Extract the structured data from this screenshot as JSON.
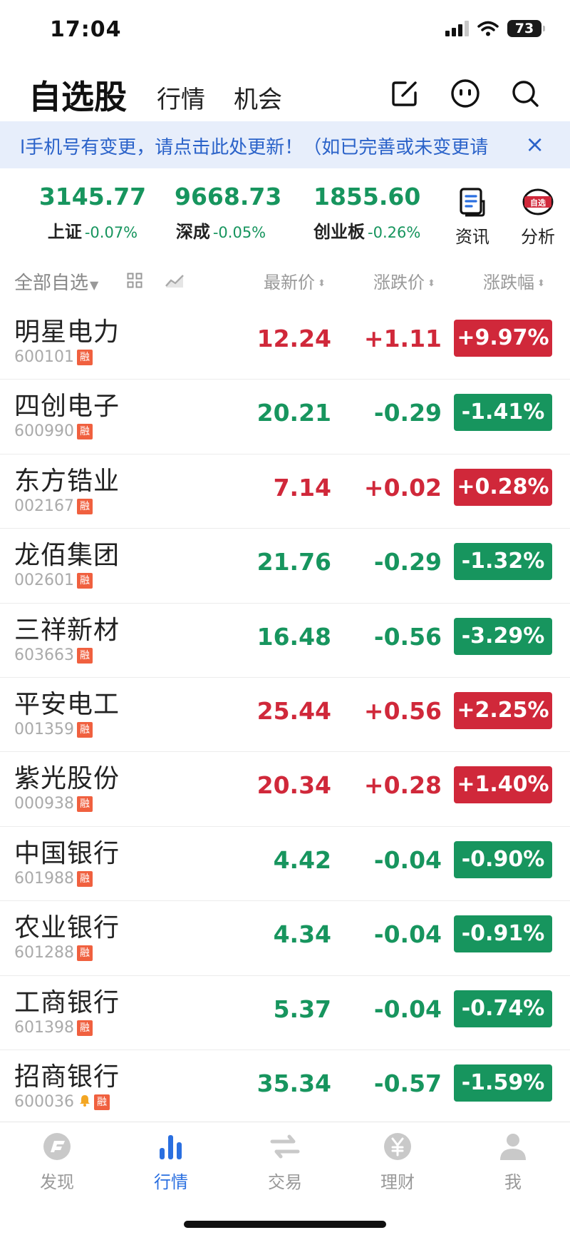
{
  "status_bar": {
    "time": "17:04",
    "battery": "73"
  },
  "header": {
    "title": "自选股",
    "tabs": [
      {
        "label": "行情"
      },
      {
        "label": "机会"
      }
    ],
    "icons": [
      "edit-icon",
      "robot-icon",
      "search-icon"
    ]
  },
  "notice": {
    "text": "l手机号有变更，请点击此处更新！（如已完善或未变更请",
    "close": "×"
  },
  "indices": [
    {
      "name": "上证",
      "value": "3145.77",
      "change": "-0.07%"
    },
    {
      "name": "深成",
      "value": "9668.73",
      "change": "-0.05%"
    },
    {
      "name": "创业板",
      "value": "1855.60",
      "change": "-0.26%"
    }
  ],
  "tools": [
    {
      "label": "资讯",
      "icon": "news-icon"
    },
    {
      "label": "分析",
      "icon": "analysis-icon",
      "badge": "自选"
    }
  ],
  "columns": {
    "all": "全部自选",
    "price": "最新价",
    "change": "涨跌价",
    "pct": "涨跌幅"
  },
  "stocks": [
    {
      "name": "明星电力",
      "code": "600101",
      "badge": "融",
      "price": "12.24",
      "change": "+1.11",
      "pct": "+9.97%",
      "dir": "up"
    },
    {
      "name": "四创电子",
      "code": "600990",
      "badge": "融",
      "price": "20.21",
      "change": "-0.29",
      "pct": "-1.41%",
      "dir": "down"
    },
    {
      "name": "东方锆业",
      "code": "002167",
      "badge": "融",
      "price": "7.14",
      "change": "+0.02",
      "pct": "+0.28%",
      "dir": "up"
    },
    {
      "name": "龙佰集团",
      "code": "002601",
      "badge": "融",
      "price": "21.76",
      "change": "-0.29",
      "pct": "-1.32%",
      "dir": "down"
    },
    {
      "name": "三祥新材",
      "code": "603663",
      "badge": "融",
      "price": "16.48",
      "change": "-0.56",
      "pct": "-3.29%",
      "dir": "down"
    },
    {
      "name": "平安电工",
      "code": "001359",
      "badge": "融",
      "price": "25.44",
      "change": "+0.56",
      "pct": "+2.25%",
      "dir": "up"
    },
    {
      "name": "紫光股份",
      "code": "000938",
      "badge": "融",
      "price": "20.34",
      "change": "+0.28",
      "pct": "+1.40%",
      "dir": "up"
    },
    {
      "name": "中国银行",
      "code": "601988",
      "badge": "融",
      "price": "4.42",
      "change": "-0.04",
      "pct": "-0.90%",
      "dir": "down"
    },
    {
      "name": "农业银行",
      "code": "601288",
      "badge": "融",
      "price": "4.34",
      "change": "-0.04",
      "pct": "-0.91%",
      "dir": "down"
    },
    {
      "name": "工商银行",
      "code": "601398",
      "badge": "融",
      "price": "5.37",
      "change": "-0.04",
      "pct": "-0.74%",
      "dir": "down"
    },
    {
      "name": "招商银行",
      "code": "600036",
      "badge": "融",
      "price": "35.34",
      "change": "-0.57",
      "pct": "-1.59%",
      "dir": "down",
      "alert": true
    }
  ],
  "bottom_nav": [
    {
      "label": "发现",
      "icon": "discover-icon"
    },
    {
      "label": "行情",
      "icon": "market-icon",
      "active": true
    },
    {
      "label": "交易",
      "icon": "trade-icon"
    },
    {
      "label": "理财",
      "icon": "wealth-icon"
    },
    {
      "label": "我",
      "icon": "profile-icon"
    }
  ],
  "colors": {
    "up": "#d0283a",
    "down": "#17955e",
    "accent": "#2a6fe0",
    "notice_bg": "#e7eefb"
  }
}
